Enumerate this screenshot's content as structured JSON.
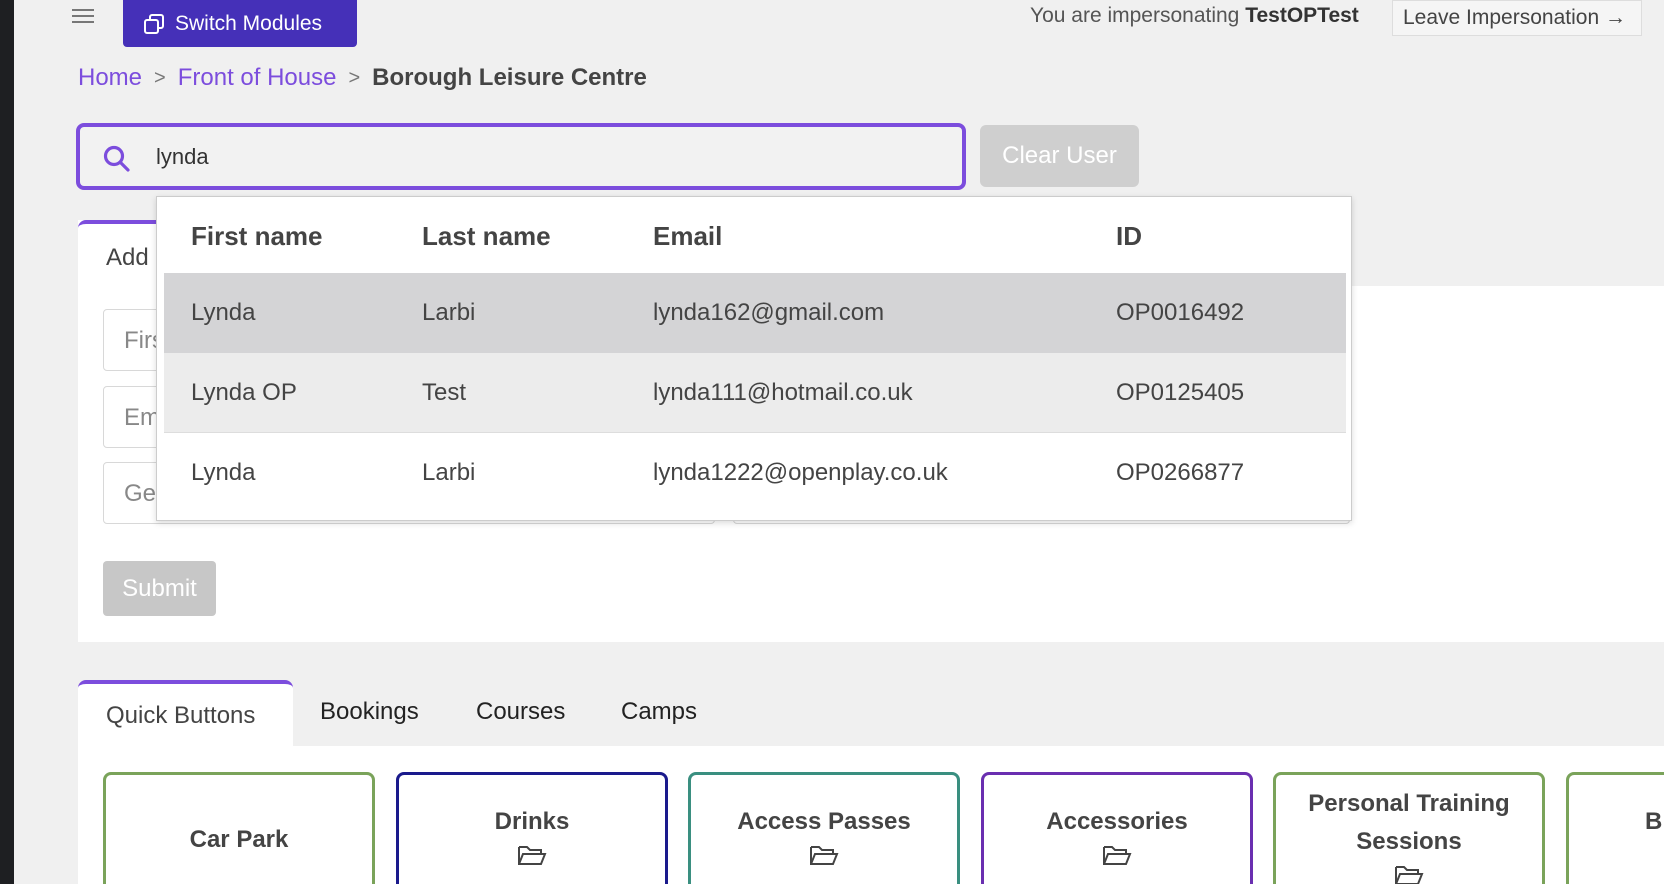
{
  "header": {
    "switch_modules": "Switch Modules",
    "impersonating_prefix": "You are impersonating",
    "impersonated_user": "TestOPTest",
    "leave_impersonation": "Leave Impersonation →"
  },
  "breadcrumb": {
    "home": "Home",
    "section": "Front of House",
    "current": "Borough Leisure Centre",
    "separator": ">"
  },
  "search": {
    "value": "lynda",
    "clear_label": "Clear User"
  },
  "form": {
    "tab_label": "Add",
    "fields": [
      "Firs",
      "Em",
      "Ge"
    ],
    "submit_label": "Submit"
  },
  "dropdown": {
    "headers": [
      "First name",
      "Last name",
      "Email",
      "ID"
    ],
    "rows": [
      [
        "Lynda",
        "Larbi",
        "lynda162@gmail.com",
        "OP0016492"
      ],
      [
        "Lynda OP",
        "Test",
        "lynda111@hotmail.co.uk",
        "OP0125405"
      ],
      [
        "Lynda",
        "Larbi",
        "lynda1222@openplay.co.uk",
        "OP0266877"
      ]
    ]
  },
  "tabs": [
    "Quick Buttons",
    "Bookings",
    "Courses",
    "Camps"
  ],
  "quick_buttons": [
    {
      "label": "Car Park",
      "color": "#7aa35a"
    },
    {
      "label": "Drinks",
      "color": "#1a1a8c"
    },
    {
      "label": "Access Passes",
      "color": "#3a8f80"
    },
    {
      "label": "Accessories",
      "color": "#6a2fb0"
    },
    {
      "label": "Personal Training Sessions",
      "color": "#7aa35a"
    },
    {
      "label": "B",
      "color": "#7aa35a"
    }
  ],
  "colors": {
    "accent": "#7c4ddd",
    "primary_button": "#4530b8",
    "row_highlight": "#d4d4d6",
    "row_hover": "#ececec"
  }
}
